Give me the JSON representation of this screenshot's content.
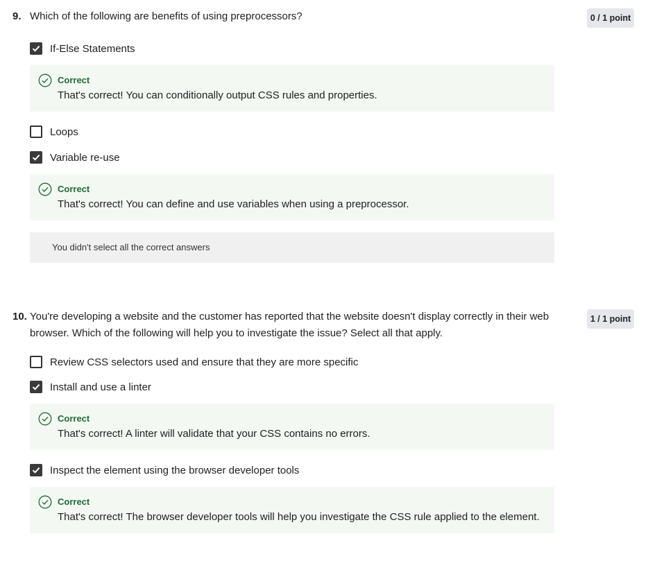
{
  "questions": [
    {
      "number": "9.",
      "text": "Which of the following are benefits of using preprocessors?",
      "score": "0 / 1 point",
      "options": [
        {
          "label": "If-Else Statements",
          "checked": true,
          "feedback": {
            "title": "Correct",
            "text": "That's correct! You can conditionally output CSS rules and properties."
          }
        },
        {
          "label": "Loops",
          "checked": false
        },
        {
          "label": "Variable re-use",
          "checked": true,
          "feedback": {
            "title": "Correct",
            "text": "That's correct! You can define and use variables when using a preprocessor."
          }
        }
      ],
      "notice": "You didn't select all the correct answers"
    },
    {
      "number": "10.",
      "text": "You're developing a website and the customer has reported that the website doesn't display correctly in their web browser. Which of the following will help you to investigate the issue? Select all that apply.",
      "score": "1 / 1 point",
      "options": [
        {
          "label": "Review CSS selectors used and ensure that they are more specific",
          "checked": false
        },
        {
          "label": "Install and use a linter",
          "checked": true,
          "feedback": {
            "title": "Correct",
            "text": "That's correct! A linter will validate that your CSS contains no errors."
          }
        },
        {
          "label": "Inspect the element using the browser developer tools",
          "checked": true,
          "feedback": {
            "title": "Correct",
            "text": "That's correct! The browser developer tools will help you investigate the CSS rule applied to the element."
          }
        }
      ]
    }
  ],
  "colors": {
    "correct": "#1f6b34",
    "feedback_bg": "#f3f8f3",
    "checkbox": "#3a3a3a"
  }
}
